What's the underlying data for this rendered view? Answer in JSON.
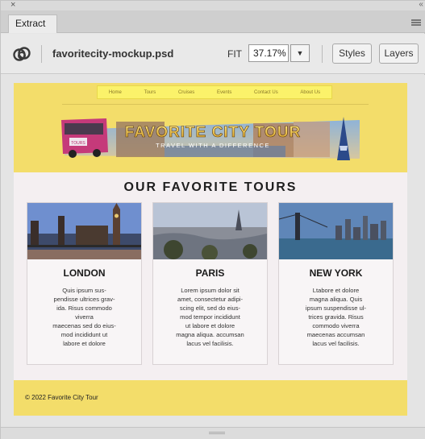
{
  "window": {
    "close_glyph": "×",
    "collapse_glyph": "‹‹"
  },
  "tab": {
    "label": "Extract"
  },
  "toolbar": {
    "filename": "favoritecity-mockup.psd",
    "fit_label": "FIT",
    "zoom_value": "37.17%",
    "zoom_dropdown_glyph": "▼",
    "styles_label": "Styles",
    "layers_label": "Layers"
  },
  "mockup": {
    "nav": [
      "Home",
      "Tours",
      "Cruises",
      "Events",
      "Contact Us",
      "About Us"
    ],
    "banner_title": "FAVORITE CITY TOUR",
    "banner_tagline": "TRAVEL WITH A DIFFERENCE",
    "bus_sign": "TOURS",
    "heading": "OUR FAVORITE TOURS",
    "cards": [
      {
        "title": "LONDON",
        "lines": [
          "Quis ipsum sus-",
          "pendisse ultrices grav-",
          "ida. Risus commodo",
          "viverra",
          "maecenas sed do eius-",
          "mod incididunt ut",
          "labore et dolore"
        ]
      },
      {
        "title": "PARIS",
        "lines": [
          "Lorem ipsum dolor sit",
          "amet, consectetur adipi-",
          "scing elit, sed do eius-",
          "mod tempor incididunt",
          "ut labore et dolore",
          "magna aliqua. accumsan",
          "lacus vel facilisis."
        ]
      },
      {
        "title": "NEW YORK",
        "lines": [
          "Ltabore et dolore",
          "magna aliqua. Quis",
          "ipsum suspendisse ul-",
          "trices gravida. Risus",
          "commodo viverra",
          "maecenas accumsan",
          "lacus vel facilisis."
        ]
      }
    ],
    "footer": "© 2022 Favorite City Tour"
  },
  "colors": {
    "page_bg": "#f3dd6a",
    "nav_bg": "#fbf26a",
    "content_bg": "#f4eff1"
  }
}
